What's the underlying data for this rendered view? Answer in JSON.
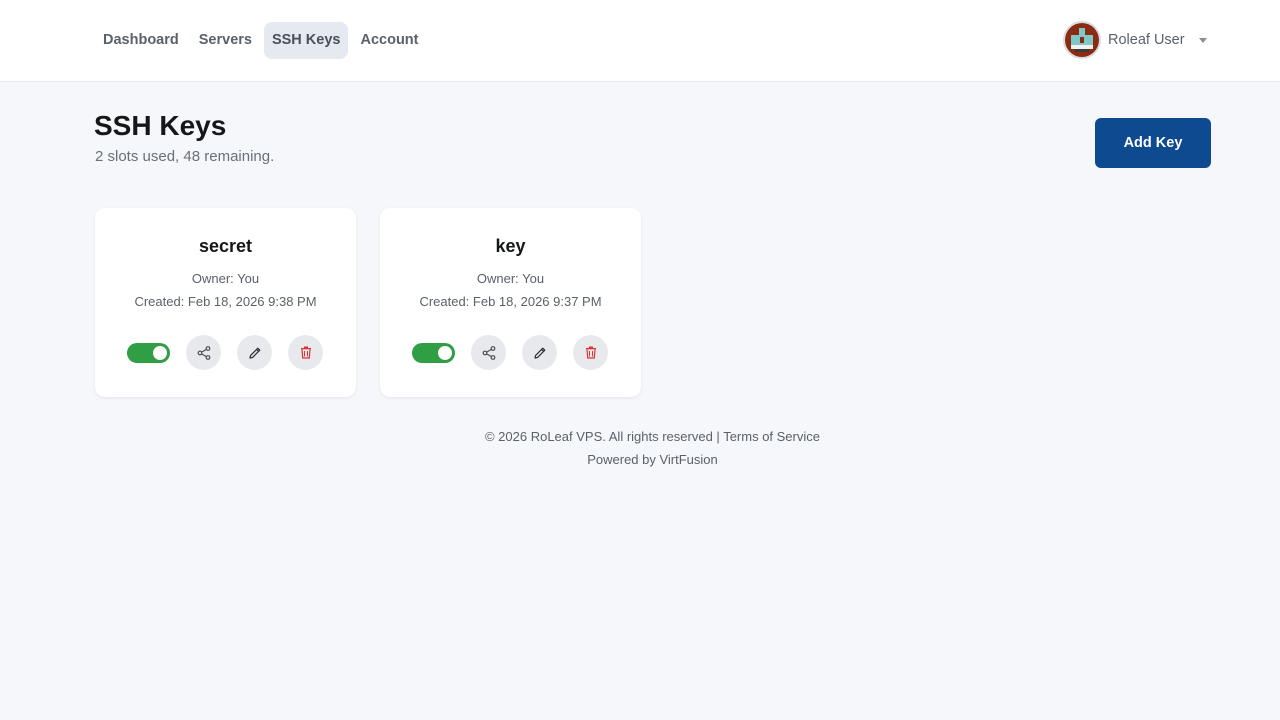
{
  "nav": {
    "items": [
      {
        "label": "Dashboard",
        "active": false
      },
      {
        "label": "Servers",
        "active": false
      },
      {
        "label": "SSH Keys",
        "active": true
      },
      {
        "label": "Account",
        "active": false
      }
    ]
  },
  "user": {
    "name": "Roleaf User",
    "avatar_icon": "pixel-avatar-icon",
    "menu_icon": "caret-down-icon"
  },
  "page": {
    "title": "SSH Keys",
    "subtitle": "2 slots used, 48 remaining.",
    "add_label": "Add Key"
  },
  "keys": [
    {
      "name": "secret",
      "owner": "Owner: You",
      "created": "Created: Feb 18, 2026 9:38 PM",
      "enabled": true
    },
    {
      "name": "key",
      "owner": "Owner: You",
      "created": "Created: Feb 18, 2026 9:37 PM",
      "enabled": true
    }
  ],
  "footer": {
    "copyright": "© 2026 RoLeaf VPS. All rights reserved |",
    "terms": "Terms of Service",
    "powered": "Powered by VirtFusion"
  },
  "colors": {
    "primary": "#0d4a8f",
    "toggle_on": "#2f9e44",
    "danger": "#e03131",
    "background": "#f5f7fa"
  }
}
